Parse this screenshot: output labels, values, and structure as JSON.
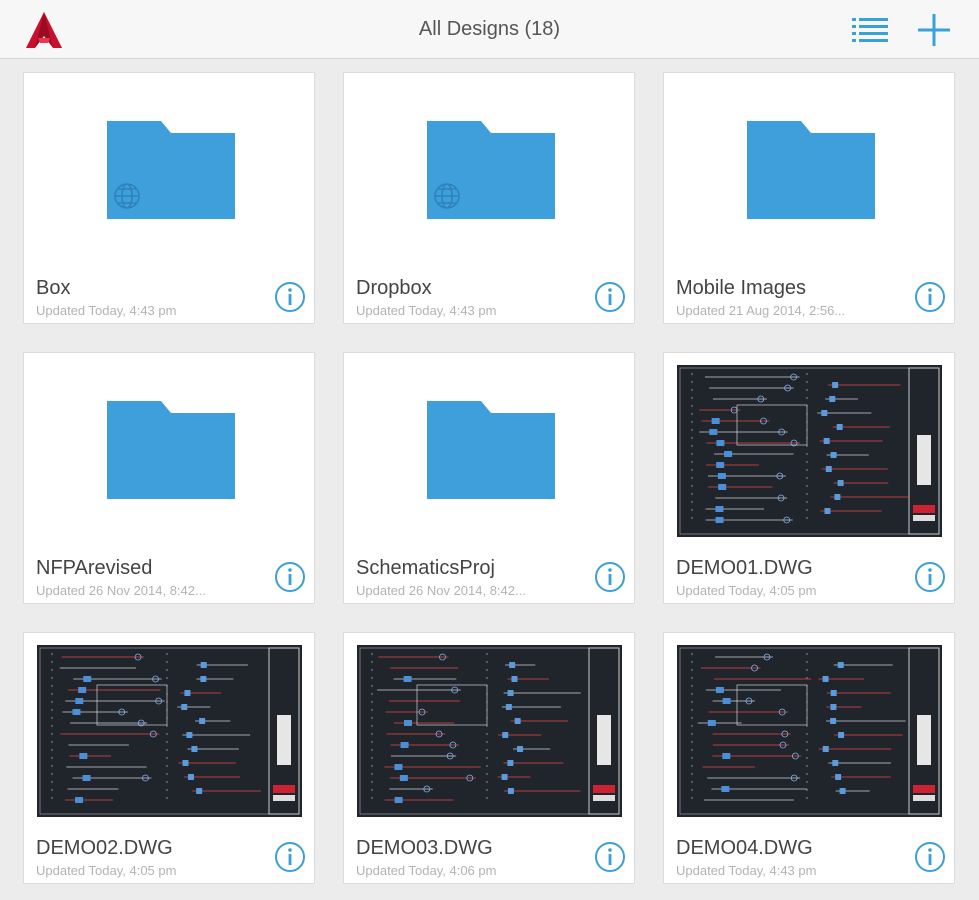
{
  "header": {
    "title": "All Designs (18)",
    "logo_icon": "autocad-logo-icon",
    "list_icon": "list-view-icon",
    "add_icon": "plus-icon"
  },
  "colors": {
    "accent": "#3aa0d8",
    "folder": "#3f9fdb",
    "logo_red": "#c8102e",
    "drawing_bg": "#20242b"
  },
  "items": [
    {
      "name": "Box",
      "meta": "Updated Today, 4:43 pm",
      "kind": "cloud-folder"
    },
    {
      "name": "Dropbox",
      "meta": "Updated Today, 4:43 pm",
      "kind": "cloud-folder"
    },
    {
      "name": "Mobile Images",
      "meta": "Updated 21 Aug 2014, 2:56...",
      "kind": "folder"
    },
    {
      "name": "NFPArevised",
      "meta": "Updated 26 Nov 2014, 8:42...",
      "kind": "folder"
    },
    {
      "name": "SchematicsProj",
      "meta": "Updated 26 Nov 2014, 8:42...",
      "kind": "folder"
    },
    {
      "name": "DEMO01.DWG",
      "meta": "Updated Today, 4:05 pm",
      "kind": "drawing"
    },
    {
      "name": "DEMO02.DWG",
      "meta": "Updated Today, 4:05 pm",
      "kind": "drawing"
    },
    {
      "name": "DEMO03.DWG",
      "meta": "Updated Today, 4:06 pm",
      "kind": "drawing"
    },
    {
      "name": "DEMO04.DWG",
      "meta": "Updated Today, 4:43 pm",
      "kind": "drawing"
    }
  ]
}
